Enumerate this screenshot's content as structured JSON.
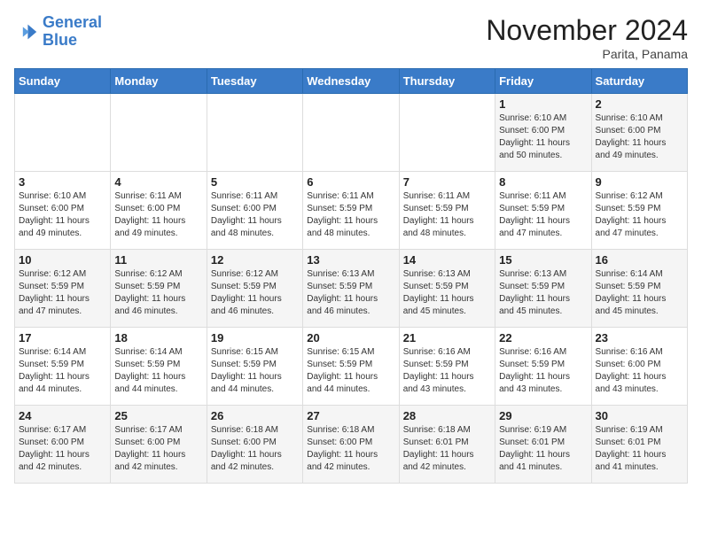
{
  "header": {
    "logo_line1": "General",
    "logo_line2": "Blue",
    "month": "November 2024",
    "location": "Parita, Panama"
  },
  "days_of_week": [
    "Sunday",
    "Monday",
    "Tuesday",
    "Wednesday",
    "Thursday",
    "Friday",
    "Saturday"
  ],
  "weeks": [
    [
      {
        "day": "",
        "info": ""
      },
      {
        "day": "",
        "info": ""
      },
      {
        "day": "",
        "info": ""
      },
      {
        "day": "",
        "info": ""
      },
      {
        "day": "",
        "info": ""
      },
      {
        "day": "1",
        "info": "Sunrise: 6:10 AM\nSunset: 6:00 PM\nDaylight: 11 hours\nand 50 minutes."
      },
      {
        "day": "2",
        "info": "Sunrise: 6:10 AM\nSunset: 6:00 PM\nDaylight: 11 hours\nand 49 minutes."
      }
    ],
    [
      {
        "day": "3",
        "info": "Sunrise: 6:10 AM\nSunset: 6:00 PM\nDaylight: 11 hours\nand 49 minutes."
      },
      {
        "day": "4",
        "info": "Sunrise: 6:11 AM\nSunset: 6:00 PM\nDaylight: 11 hours\nand 49 minutes."
      },
      {
        "day": "5",
        "info": "Sunrise: 6:11 AM\nSunset: 6:00 PM\nDaylight: 11 hours\nand 48 minutes."
      },
      {
        "day": "6",
        "info": "Sunrise: 6:11 AM\nSunset: 5:59 PM\nDaylight: 11 hours\nand 48 minutes."
      },
      {
        "day": "7",
        "info": "Sunrise: 6:11 AM\nSunset: 5:59 PM\nDaylight: 11 hours\nand 48 minutes."
      },
      {
        "day": "8",
        "info": "Sunrise: 6:11 AM\nSunset: 5:59 PM\nDaylight: 11 hours\nand 47 minutes."
      },
      {
        "day": "9",
        "info": "Sunrise: 6:12 AM\nSunset: 5:59 PM\nDaylight: 11 hours\nand 47 minutes."
      }
    ],
    [
      {
        "day": "10",
        "info": "Sunrise: 6:12 AM\nSunset: 5:59 PM\nDaylight: 11 hours\nand 47 minutes."
      },
      {
        "day": "11",
        "info": "Sunrise: 6:12 AM\nSunset: 5:59 PM\nDaylight: 11 hours\nand 46 minutes."
      },
      {
        "day": "12",
        "info": "Sunrise: 6:12 AM\nSunset: 5:59 PM\nDaylight: 11 hours\nand 46 minutes."
      },
      {
        "day": "13",
        "info": "Sunrise: 6:13 AM\nSunset: 5:59 PM\nDaylight: 11 hours\nand 46 minutes."
      },
      {
        "day": "14",
        "info": "Sunrise: 6:13 AM\nSunset: 5:59 PM\nDaylight: 11 hours\nand 45 minutes."
      },
      {
        "day": "15",
        "info": "Sunrise: 6:13 AM\nSunset: 5:59 PM\nDaylight: 11 hours\nand 45 minutes."
      },
      {
        "day": "16",
        "info": "Sunrise: 6:14 AM\nSunset: 5:59 PM\nDaylight: 11 hours\nand 45 minutes."
      }
    ],
    [
      {
        "day": "17",
        "info": "Sunrise: 6:14 AM\nSunset: 5:59 PM\nDaylight: 11 hours\nand 44 minutes."
      },
      {
        "day": "18",
        "info": "Sunrise: 6:14 AM\nSunset: 5:59 PM\nDaylight: 11 hours\nand 44 minutes."
      },
      {
        "day": "19",
        "info": "Sunrise: 6:15 AM\nSunset: 5:59 PM\nDaylight: 11 hours\nand 44 minutes."
      },
      {
        "day": "20",
        "info": "Sunrise: 6:15 AM\nSunset: 5:59 PM\nDaylight: 11 hours\nand 44 minutes."
      },
      {
        "day": "21",
        "info": "Sunrise: 6:16 AM\nSunset: 5:59 PM\nDaylight: 11 hours\nand 43 minutes."
      },
      {
        "day": "22",
        "info": "Sunrise: 6:16 AM\nSunset: 5:59 PM\nDaylight: 11 hours\nand 43 minutes."
      },
      {
        "day": "23",
        "info": "Sunrise: 6:16 AM\nSunset: 6:00 PM\nDaylight: 11 hours\nand 43 minutes."
      }
    ],
    [
      {
        "day": "24",
        "info": "Sunrise: 6:17 AM\nSunset: 6:00 PM\nDaylight: 11 hours\nand 42 minutes."
      },
      {
        "day": "25",
        "info": "Sunrise: 6:17 AM\nSunset: 6:00 PM\nDaylight: 11 hours\nand 42 minutes."
      },
      {
        "day": "26",
        "info": "Sunrise: 6:18 AM\nSunset: 6:00 PM\nDaylight: 11 hours\nand 42 minutes."
      },
      {
        "day": "27",
        "info": "Sunrise: 6:18 AM\nSunset: 6:00 PM\nDaylight: 11 hours\nand 42 minutes."
      },
      {
        "day": "28",
        "info": "Sunrise: 6:18 AM\nSunset: 6:01 PM\nDaylight: 11 hours\nand 42 minutes."
      },
      {
        "day": "29",
        "info": "Sunrise: 6:19 AM\nSunset: 6:01 PM\nDaylight: 11 hours\nand 41 minutes."
      },
      {
        "day": "30",
        "info": "Sunrise: 6:19 AM\nSunset: 6:01 PM\nDaylight: 11 hours\nand 41 minutes."
      }
    ]
  ]
}
